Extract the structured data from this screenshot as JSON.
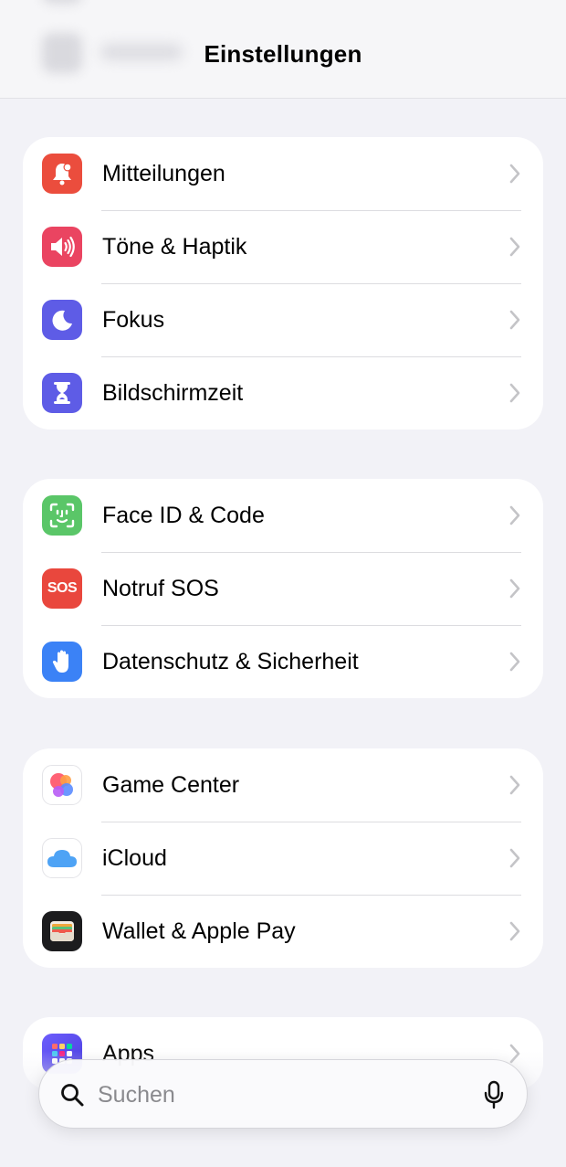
{
  "header": {
    "title": "Einstellungen"
  },
  "groups": [
    {
      "items": [
        {
          "label": "Mitteilungen",
          "icon": "notifications-icon",
          "color": "#eb4d3d"
        },
        {
          "label": "Töne & Haptik",
          "icon": "sounds-icon",
          "color": "#ea4461"
        },
        {
          "label": "Fokus",
          "icon": "focus-moon-icon",
          "color": "#5e5ce6"
        },
        {
          "label": "Bildschirmzeit",
          "icon": "screen-time-hourglass-icon",
          "color": "#5e5ce6"
        }
      ]
    },
    {
      "items": [
        {
          "label": "Face ID & Code",
          "icon": "face-id-icon",
          "color": "#5ac668"
        },
        {
          "label": "Notruf SOS",
          "icon": "sos-icon",
          "color": "#e9473d",
          "icon_text": "SOS"
        },
        {
          "label": "Datenschutz & Sicherheit",
          "icon": "privacy-hand-icon",
          "color": "#3b82f6"
        }
      ]
    },
    {
      "items": [
        {
          "label": "Game Center",
          "icon": "game-center-icon",
          "color": "#ffffff"
        },
        {
          "label": "iCloud",
          "icon": "icloud-icon",
          "color": "#ffffff"
        },
        {
          "label": "Wallet & Apple Pay",
          "icon": "wallet-icon",
          "color": "#1c1c1e"
        }
      ]
    },
    {
      "items": [
        {
          "label": "Apps",
          "icon": "apps-grid-icon",
          "color": "#6d5dfc"
        }
      ]
    }
  ],
  "search": {
    "placeholder": "Suchen"
  }
}
